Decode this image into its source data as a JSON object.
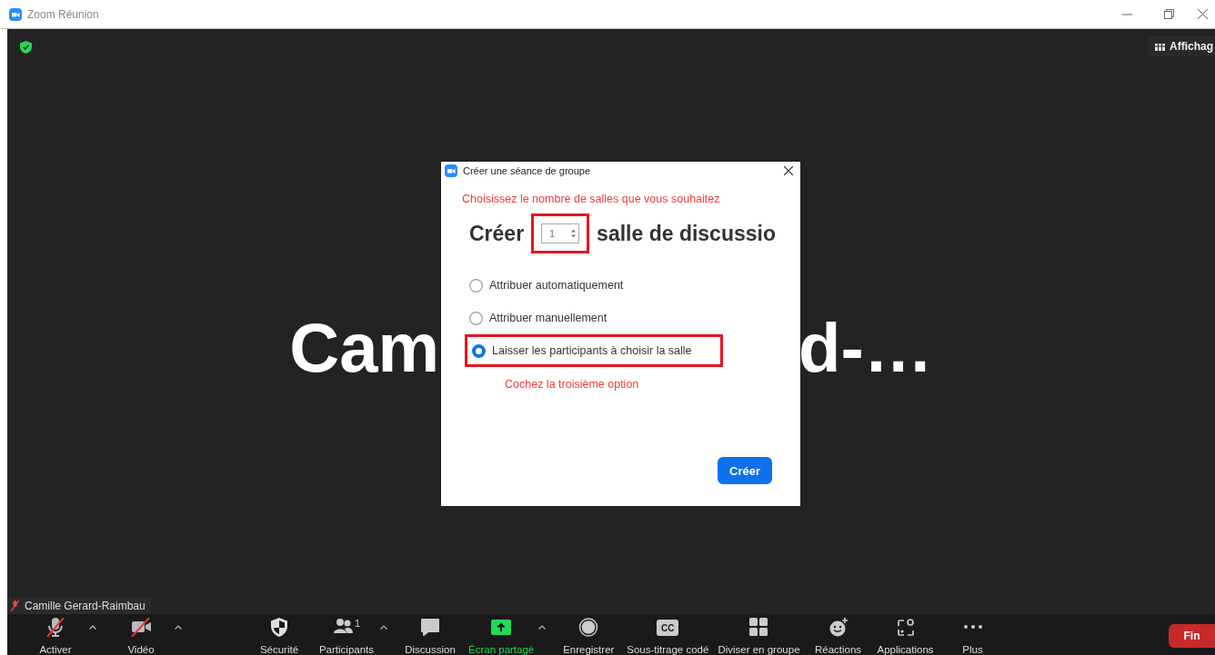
{
  "window": {
    "title": "Zoom Réunion"
  },
  "view_button": {
    "label": "Affichag"
  },
  "stage": {
    "name_start": "Cam",
    "name_end": "d-…",
    "name_tag": {
      "label": "Camille Gerard-Raimbau",
      "muted": true
    }
  },
  "dialog": {
    "title": "Créer une séance de groupe",
    "instruction": "Choisissez le nombre de salles que vous souhaitez",
    "count_prefix": "Créer",
    "room_count": "1",
    "count_suffix": "salle de discussio",
    "options": [
      {
        "label": "Attribuer automatiquement",
        "selected": false
      },
      {
        "label": "Attribuer manuellement",
        "selected": false
      },
      {
        "label": "Laisser les participants à choisir la salle",
        "selected": true
      }
    ],
    "hint": "Cochez la troisième option",
    "submit": "Créer"
  },
  "toolbar": {
    "items": [
      {
        "kind": "mic",
        "label": "Activer",
        "muted": true,
        "caret": true
      },
      {
        "kind": "video",
        "label": "Vidéo",
        "muted": true,
        "caret": true
      },
      {
        "kind": "security",
        "label": "Sécurité"
      },
      {
        "kind": "participants",
        "label": "Participants",
        "count": "1",
        "caret": true
      },
      {
        "kind": "chat",
        "label": "Discussion"
      },
      {
        "kind": "share",
        "label": "Écran partagé",
        "caret": true
      },
      {
        "kind": "record",
        "label": "Enregistrer"
      },
      {
        "kind": "captions",
        "label": "Sous-titrage codé",
        "icon_text": "CC"
      },
      {
        "kind": "breakout",
        "label": "Diviser en groupe"
      },
      {
        "kind": "reactions",
        "label": "Réactions"
      },
      {
        "kind": "apps",
        "label": "Applications"
      },
      {
        "kind": "more",
        "label": "Plus"
      }
    ],
    "end_button": "Fin"
  }
}
